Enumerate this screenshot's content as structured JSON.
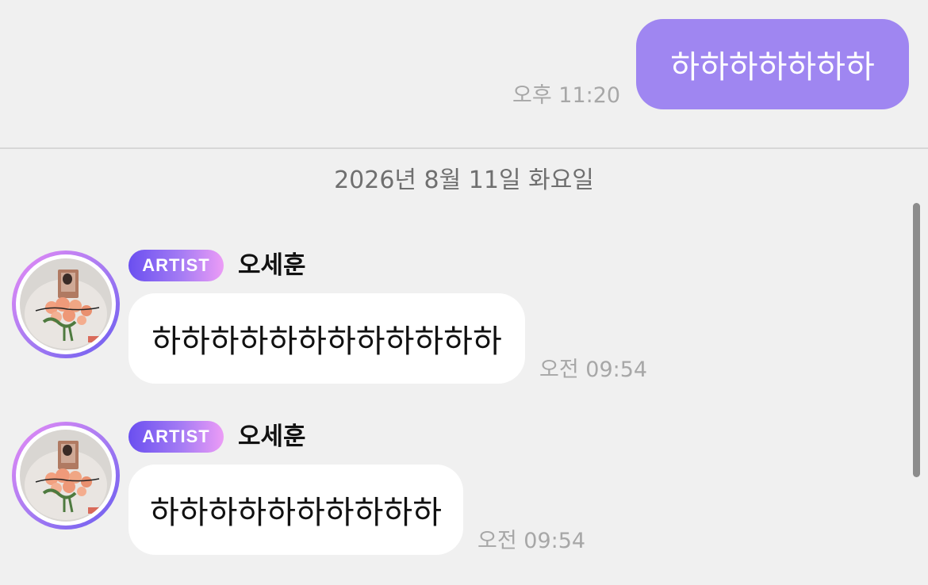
{
  "colors": {
    "background": "#f0f0f0",
    "sent_bubble": "#9f86f1",
    "received_bubble": "#ffffff",
    "badge_gradient": [
      "#6a4ff0",
      "#a47bf4",
      "#ec9cf6"
    ],
    "time_text": "#a7a7a7"
  },
  "sent_message": {
    "text": "하하하하하하하",
    "time": "오후 11:20"
  },
  "date_separator": "2026년 8월 11일 화요일",
  "received_messages": [
    {
      "badge": "ARTIST",
      "sender": "오세훈",
      "text": "하하하하하하하하하하하하",
      "time": "오전 09:54",
      "avatar": "profile-photo-avatar"
    },
    {
      "badge": "ARTIST",
      "sender": "오세훈",
      "text": "하하하하하하하하하하",
      "time": "오전 09:54",
      "avatar": "profile-photo-avatar"
    }
  ]
}
